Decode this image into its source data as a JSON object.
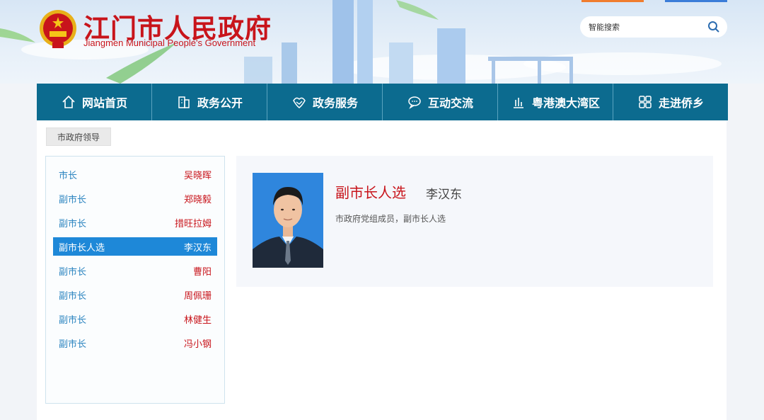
{
  "header": {
    "site_name_cn": "江门市人民政府",
    "site_name_en": "Jiangmen Municipal People's Government",
    "search_placeholder": "智能搜索"
  },
  "nav": {
    "items": [
      {
        "label": "网站首页",
        "icon": "home-icon"
      },
      {
        "label": "政务公开",
        "icon": "building-icon"
      },
      {
        "label": "政务服务",
        "icon": "handshake-icon"
      },
      {
        "label": "互动交流",
        "icon": "chat-icon"
      },
      {
        "label": "粤港澳大湾区",
        "icon": "bar-chart-icon"
      },
      {
        "label": "走进侨乡",
        "icon": "grid-icon"
      }
    ]
  },
  "breadcrumb": {
    "label": "市政府领导"
  },
  "leaders": [
    {
      "title": "市长",
      "name": "吴晓晖",
      "active": false
    },
    {
      "title": "副市长",
      "name": "郑晓毅",
      "active": false
    },
    {
      "title": "副市长",
      "name": "措旺拉姆",
      "active": false
    },
    {
      "title": "副市长人选",
      "name": "李汉东",
      "active": true
    },
    {
      "title": "副市长",
      "name": "曹阳",
      "active": false
    },
    {
      "title": "副市长",
      "name": "周佩珊",
      "active": false
    },
    {
      "title": "副市长",
      "name": "林健生",
      "active": false
    },
    {
      "title": "副市长",
      "name": "冯小钢",
      "active": false
    }
  ],
  "profile": {
    "title": "副市长人选",
    "name": "李汉东",
    "description": "市政府党组成员，副市长人选"
  },
  "colors": {
    "brand_red": "#c8141b",
    "nav_blue": "#0c6b8f",
    "active_blue": "#1e88d8",
    "link_blue": "#2e86c1"
  }
}
